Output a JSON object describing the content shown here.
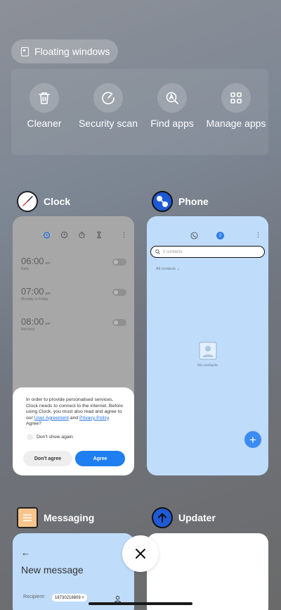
{
  "floating": {
    "label": "Floating windows"
  },
  "tools": [
    {
      "id": "cleaner",
      "label": "Cleaner",
      "icon": "trash-icon"
    },
    {
      "id": "security",
      "label": "Security scan",
      "icon": "gauge-icon"
    },
    {
      "id": "findapps",
      "label": "Find apps",
      "icon": "search-apps-icon"
    },
    {
      "id": "manage",
      "label": "Manage apps",
      "icon": "grid-icon"
    }
  ],
  "apps": {
    "clock": {
      "name": "Clock",
      "alarms": [
        {
          "time": "06:00",
          "ampm": "am",
          "sub": "Daily"
        },
        {
          "time": "07:00",
          "ampm": "am",
          "sub": "Monday to Friday"
        },
        {
          "time": "08:00",
          "ampm": "am",
          "sub": "Not fired"
        }
      ],
      "consent": {
        "text_before": "In order to provide personalised services, Clock needs to connect to the internet. Before using Clock, you must also read and agree to our ",
        "link_agreement": "User Agreement",
        "text_and": " and ",
        "link_privacy": "Privacy Policy",
        "text_after": ". Agree?",
        "dont_show": "Don't show again",
        "disagree": "Don't agree",
        "agree": "Agree"
      }
    },
    "phone": {
      "name": "Phone",
      "search_placeholder": "0 contacts",
      "filter": "All contacts",
      "empty": "No contacts",
      "tab_badge": "2",
      "fab": "+"
    },
    "messaging": {
      "name": "Messaging",
      "back": "←",
      "title": "New message",
      "recipient_label": "Recipient:",
      "recipient_value": "18730218809"
    },
    "updater": {
      "name": "Updater"
    }
  },
  "close": {
    "icon": "close-icon"
  },
  "colors": {
    "accent": "#1f7ef0",
    "phone_bg": "#bfdcfb",
    "clock_bg": "#a7a7a7"
  }
}
